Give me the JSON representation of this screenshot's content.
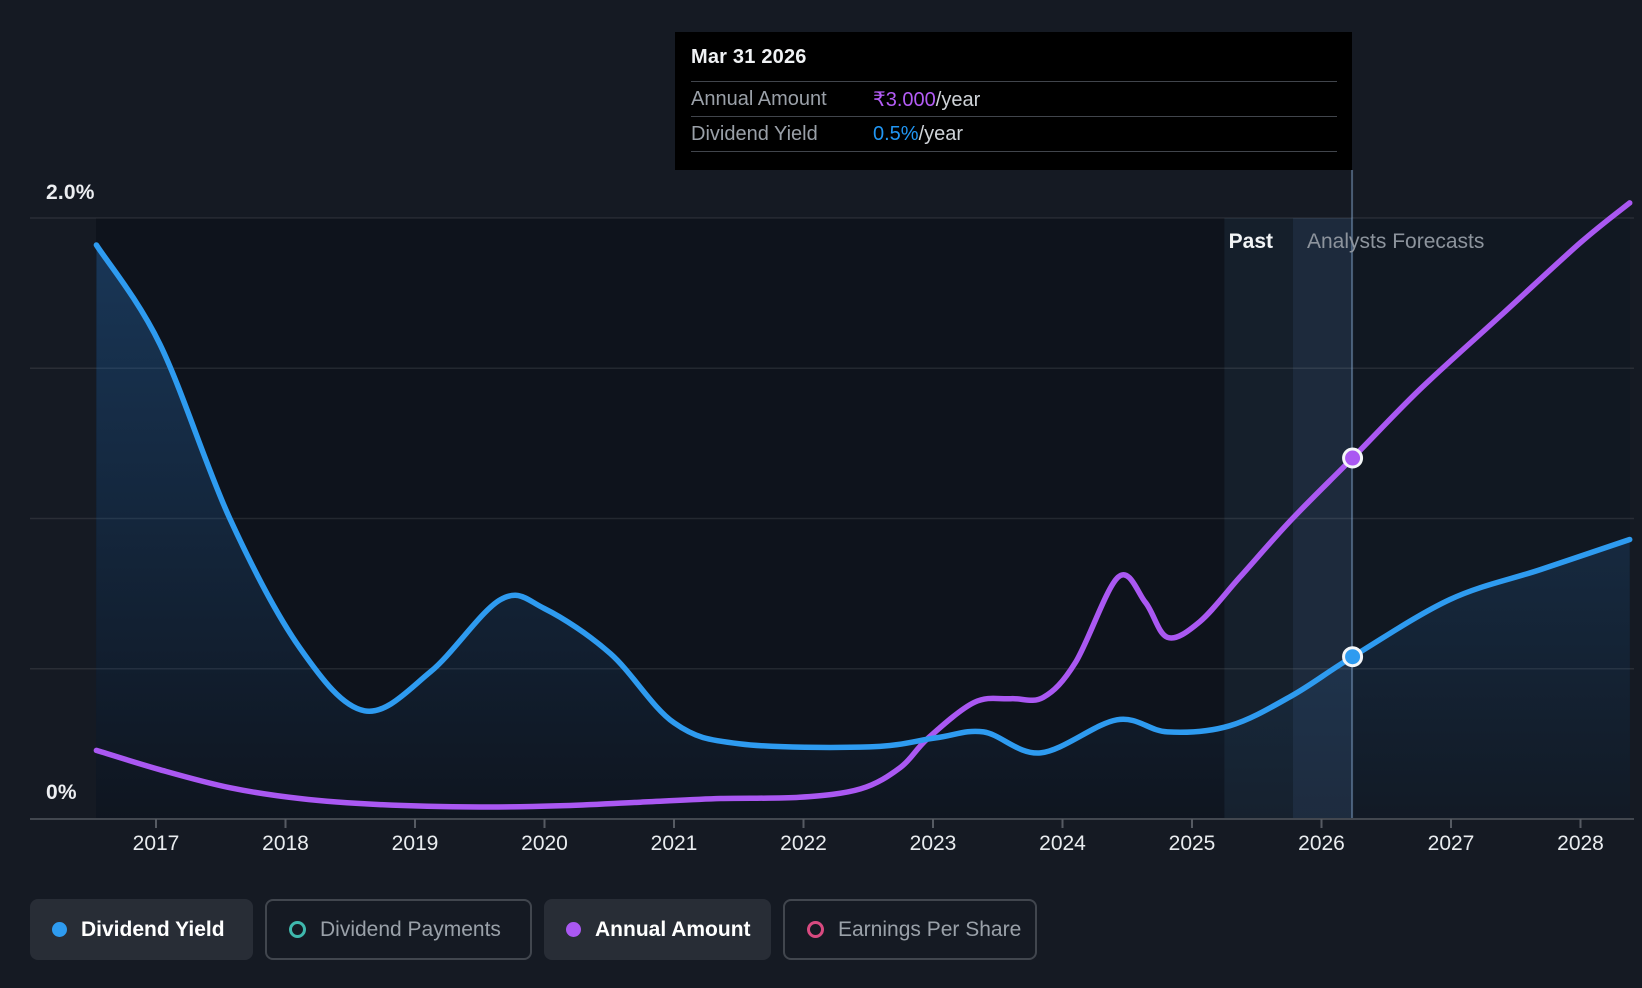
{
  "tooltip": {
    "date": "Mar 31 2026",
    "rows": [
      {
        "label": "Annual Amount",
        "value": "₹3.000",
        "suffix": "/year"
      },
      {
        "label": "Dividend Yield",
        "value": "0.5%",
        "suffix": "/year"
      }
    ]
  },
  "axis": {
    "y_top_label": "2.0%",
    "y_bottom_label": "0%"
  },
  "zones": {
    "past_label": "Past",
    "forecast_label": "Analysts Forecasts"
  },
  "legend": [
    {
      "label": "Dividend Yield",
      "color": "#2e9bf0",
      "style": "filled",
      "active": true
    },
    {
      "label": "Dividend Payments",
      "color": "#3fb8ad",
      "style": "ring",
      "active": false
    },
    {
      "label": "Annual Amount",
      "color": "#aa58f2",
      "style": "filled",
      "active": true
    },
    {
      "label": "Earnings Per Share",
      "color": "#d84a80",
      "style": "ring",
      "active": false
    }
  ],
  "timeline": {
    "band_start_year": 2025.25,
    "today_year": 2025.78,
    "hover_year": 2026.236
  },
  "chart_data": {
    "type": "line",
    "title": "Dividend history and forecast",
    "x_axis": {
      "ticks": [
        2017,
        2018,
        2019,
        2020,
        2021,
        2022,
        2023,
        2024,
        2025,
        2026,
        2027,
        2028
      ],
      "range": [
        2016.49,
        2028.42
      ]
    },
    "y_axis": {
      "unit": "%",
      "range": [
        0,
        2.0
      ],
      "gridlines_pct": [
        2.0,
        1.5,
        1.0,
        0.5,
        0.0
      ],
      "labeled": [
        "2.0%",
        "0%"
      ]
    },
    "series": [
      {
        "name": "Dividend Yield",
        "unit": "%",
        "color": "#2e9bf0",
        "area": true,
        "points": [
          [
            2016.54,
            1.91
          ],
          [
            2017.03,
            1.58
          ],
          [
            2017.57,
            1.0
          ],
          [
            2018.11,
            0.57
          ],
          [
            2018.61,
            0.36
          ],
          [
            2019.12,
            0.49
          ],
          [
            2019.66,
            0.73
          ],
          [
            2020.0,
            0.7
          ],
          [
            2020.51,
            0.55
          ],
          [
            2021.0,
            0.32
          ],
          [
            2021.51,
            0.25
          ],
          [
            2022.51,
            0.24
          ],
          [
            2023.02,
            0.27
          ],
          [
            2023.39,
            0.29
          ],
          [
            2023.83,
            0.22
          ],
          [
            2024.42,
            0.33
          ],
          [
            2024.81,
            0.29
          ],
          [
            2025.29,
            0.31
          ],
          [
            2025.77,
            0.41
          ],
          [
            2026.24,
            0.54
          ],
          [
            2026.99,
            0.73
          ],
          [
            2027.69,
            0.83
          ],
          [
            2028.38,
            0.93
          ]
        ]
      },
      {
        "name": "Annual Amount",
        "unit": "₹/year",
        "color": "#aa58f2",
        "area": false,
        "points": [
          [
            2016.54,
            0.57
          ],
          [
            2017.03,
            0.41
          ],
          [
            2017.57,
            0.26
          ],
          [
            2018.11,
            0.17
          ],
          [
            2018.73,
            0.12
          ],
          [
            2019.5,
            0.1
          ],
          [
            2020.12,
            0.11
          ],
          [
            2020.74,
            0.14
          ],
          [
            2021.36,
            0.17
          ],
          [
            2021.97,
            0.18
          ],
          [
            2022.44,
            0.25
          ],
          [
            2022.75,
            0.43
          ],
          [
            2022.96,
            0.67
          ],
          [
            2023.32,
            0.97
          ],
          [
            2023.6,
            1.0
          ],
          [
            2023.85,
            1.01
          ],
          [
            2024.1,
            1.3
          ],
          [
            2024.43,
            2.01
          ],
          [
            2024.64,
            1.8
          ],
          [
            2024.81,
            1.51
          ],
          [
            2025.06,
            1.64
          ],
          [
            2025.37,
            2.01
          ],
          [
            2025.77,
            2.49
          ],
          [
            2026.24,
            3.0
          ],
          [
            2026.76,
            3.57
          ],
          [
            2027.38,
            4.18
          ],
          [
            2028.0,
            4.79
          ],
          [
            2028.38,
            5.12
          ]
        ]
      }
    ],
    "markers": {
      "year": 2026.24,
      "dividend_yield_pct": 0.54,
      "annual_amount_inr": 3.0
    }
  }
}
